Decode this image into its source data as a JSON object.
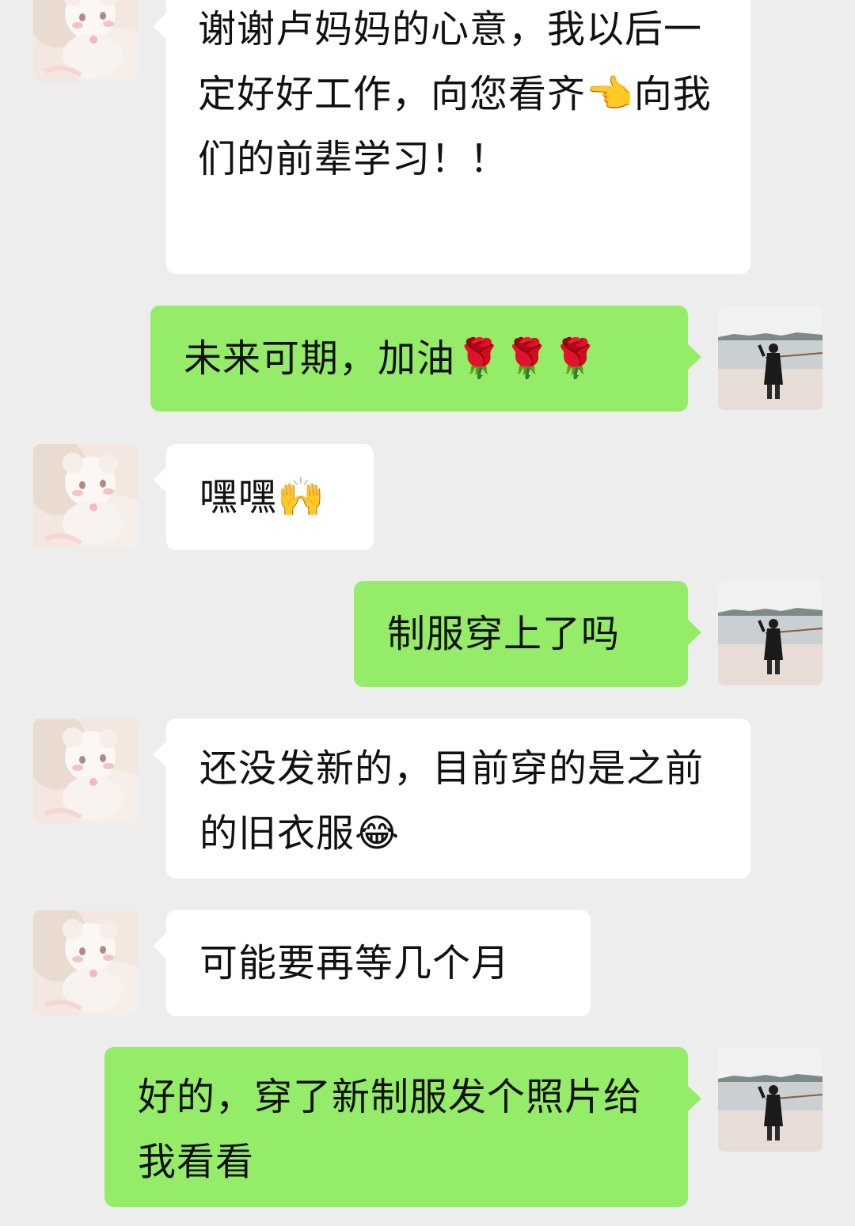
{
  "chat": {
    "messages": [
      {
        "sender": "contact",
        "text": "谢谢卢妈妈的心意，我以后一定好好工作，向您看齐👈向我们的前辈学习！！"
      },
      {
        "sender": "me",
        "text": "未来可期，加油🌹🌹🌹"
      },
      {
        "sender": "contact",
        "text": "嘿嘿🙌"
      },
      {
        "sender": "me",
        "text": "制服穿上了吗"
      },
      {
        "sender": "contact",
        "text": "还没发新的，目前穿的是之前的旧衣服😂"
      },
      {
        "sender": "contact",
        "text": "可能要再等几个月"
      },
      {
        "sender": "me",
        "text": "好的，穿了新制服发个照片给我看看"
      }
    ]
  },
  "colors": {
    "background": "#ededed",
    "incoming_bubble": "#ffffff",
    "outgoing_bubble": "#95ec69"
  },
  "avatars": {
    "contact": "plush-toy-avatar-icon",
    "me": "beach-photo-avatar-icon"
  }
}
